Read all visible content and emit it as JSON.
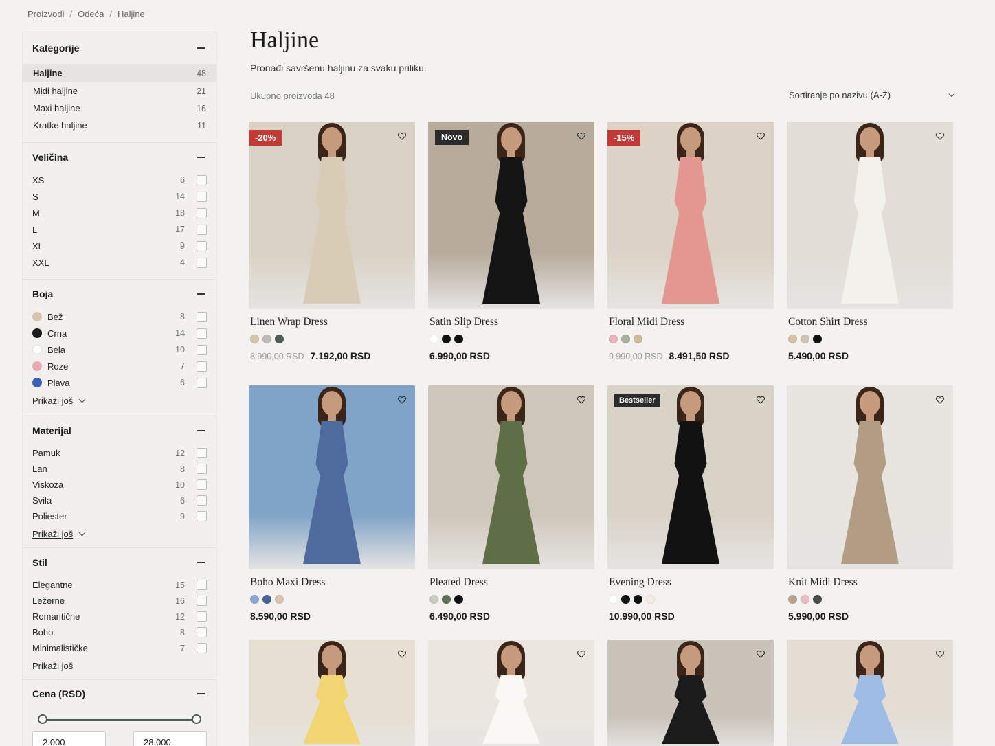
{
  "breadcrumb": [
    "Proizvodi",
    "Odeća",
    "Haljine"
  ],
  "sidebar": {
    "categories": {
      "title": "Kategorije",
      "items": [
        {
          "label": "Haljine",
          "count": "48",
          "active": true
        },
        {
          "label": "Midi haljine",
          "count": "21"
        },
        {
          "label": "Maxi haljine",
          "count": "16"
        },
        {
          "label": "Kratke haljine",
          "count": "11"
        }
      ]
    },
    "size": {
      "title": "Veličina",
      "items": [
        {
          "label": "XS",
          "count": "6"
        },
        {
          "label": "S",
          "count": "14"
        },
        {
          "label": "M",
          "count": "18"
        },
        {
          "label": "L",
          "count": "17"
        },
        {
          "label": "XL",
          "count": "9"
        },
        {
          "label": "XXL",
          "count": "4"
        }
      ]
    },
    "color": {
      "title": "Boja",
      "items": [
        {
          "label": "Bež",
          "count": "8",
          "swatch": "#d9c4aa"
        },
        {
          "label": "Crna",
          "count": "14",
          "swatch": "#1a1a1a"
        },
        {
          "label": "Bela",
          "count": "10",
          "swatch": "#ffffff"
        },
        {
          "label": "Roze",
          "count": "7",
          "swatch": "#e8a9b3"
        },
        {
          "label": "Plava",
          "count": "6",
          "swatch": "#3b62b5"
        }
      ],
      "more": "Prikaži još"
    },
    "material": {
      "title": "Materijal",
      "items": [
        {
          "label": "Pamuk",
          "count": "12"
        },
        {
          "label": "Lan",
          "count": "8"
        },
        {
          "label": "Viskoza",
          "count": "10"
        },
        {
          "label": "Svila",
          "count": "6"
        },
        {
          "label": "Poliester",
          "count": "9"
        }
      ],
      "more": "Prikaži još"
    },
    "style": {
      "title": "Stil",
      "items": [
        {
          "label": "Elegantne",
          "count": "15"
        },
        {
          "label": "Ležerne",
          "count": "16"
        },
        {
          "label": "Romantične",
          "count": "12"
        },
        {
          "label": "Boho",
          "count": "8"
        },
        {
          "label": "Minimalističke",
          "count": "7"
        }
      ],
      "more": "Prikaži još"
    },
    "price": {
      "title": "Cena (RSD)",
      "min": "2.000",
      "max": "28.000"
    }
  },
  "main": {
    "title": "Haljine",
    "subtitle": "Pronađi savršenu haljinu za svaku priliku.",
    "total": "Ukupno proizvoda 48",
    "sort": "Sortiranje po nazivu (A-Ž)"
  },
  "products": [
    {
      "name": "Linen Wrap Dress",
      "badge": "-20%",
      "badge_type": "red",
      "old_price": "8.990,00 RSD",
      "price": "7.192,00 RSD",
      "colors": [
        "#d5c6ad",
        "#bdbbb6",
        "#4b5f58"
      ],
      "bg": "#d9d1c4",
      "dress": "#d8ccb7"
    },
    {
      "name": "Satin Slip Dress",
      "badge": "Novo",
      "badge_type": "dark",
      "old_price": "",
      "price": "6.990,00 RSD",
      "colors": [
        "#ffffff",
        "#111111",
        "#111111"
      ],
      "bg": "#b7ab9c",
      "dress": "#141414"
    },
    {
      "name": "Floral Midi Dress",
      "badge": "-15%",
      "badge_type": "red",
      "old_price": "9.990,00 RSD",
      "price": "8.491,50 RSD",
      "colors": [
        "#eab4b8",
        "#a5b398",
        "#cfb99a"
      ],
      "bg": "#dcd3c6",
      "dress": "#e39790"
    },
    {
      "name": "Cotton Shirt Dress",
      "badge": "",
      "badge_type": "",
      "old_price": "",
      "price": "5.490,00 RSD",
      "colors": [
        "#d8c3a7",
        "#cfc3b3",
        "#111111"
      ],
      "bg": "#e2ddd6",
      "dress": "#f3f1ec"
    },
    {
      "name": "Boho Maxi Dress",
      "badge": "",
      "badge_type": "",
      "old_price": "",
      "price": "8.590,00 RSD",
      "colors": [
        "#8ea8d2",
        "#4a6395",
        "#dcc4b1"
      ],
      "bg": "#7fa4c7",
      "dress": "#4f6a9d"
    },
    {
      "name": "Pleated Dress",
      "badge": "",
      "badge_type": "",
      "old_price": "",
      "price": "6.490,00 RSD",
      "colors": [
        "#c8cfbf",
        "#5e7056",
        "#111111"
      ],
      "bg": "#cfc6ba",
      "dress": "#5e6e46"
    },
    {
      "name": "Evening Dress",
      "badge": "Bestseller",
      "badge_type": "small",
      "old_price": "",
      "price": "10.990,00 RSD",
      "colors": [
        "#ffffff",
        "#111111",
        "#111111",
        "#f4ece2"
      ],
      "bg": "#d9d2c7",
      "dress": "#121212"
    },
    {
      "name": "Knit Midi Dress",
      "badge": "",
      "badge_type": "",
      "old_price": "",
      "price": "5.990,00 RSD",
      "colors": [
        "#b9a48f",
        "#ecbcc4",
        "#4a4a4a"
      ],
      "bg": "#e8e5e0",
      "dress": "#b39c84"
    },
    {
      "name": "",
      "badge": "",
      "badge_type": "",
      "old_price": "",
      "price": "",
      "colors": [],
      "bg": "#e7dfd2",
      "dress": "#f1d572"
    },
    {
      "name": "",
      "badge": "",
      "badge_type": "",
      "old_price": "",
      "price": "",
      "colors": [],
      "bg": "#ebe6df",
      "dress": "#faf8f4"
    },
    {
      "name": "",
      "badge": "",
      "badge_type": "",
      "old_price": "",
      "price": "",
      "colors": [],
      "bg": "#c9c3ba",
      "dress": "#1b1b1b"
    },
    {
      "name": "",
      "badge": "",
      "badge_type": "",
      "old_price": "",
      "price": "",
      "colors": [],
      "bg": "#e3ddd4",
      "dress": "#9fbde4"
    }
  ]
}
